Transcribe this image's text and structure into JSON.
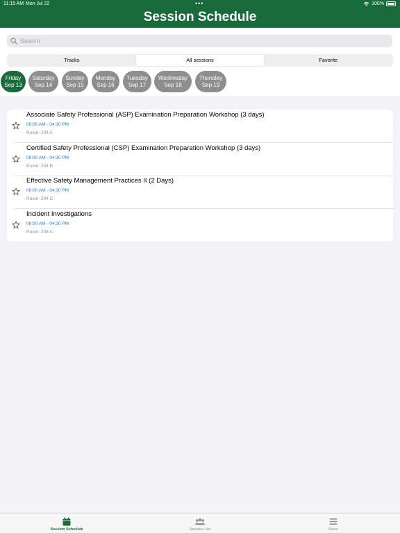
{
  "status_bar": {
    "time": "11:15 AM",
    "date": "Mon Jul 22",
    "dots": "•••",
    "battery": "100%"
  },
  "header": {
    "title": "Session Schedule"
  },
  "search": {
    "placeholder": "Search"
  },
  "segments": [
    {
      "label": "Tracks",
      "active": false
    },
    {
      "label": "All sessions",
      "active": true
    },
    {
      "label": "Favorite",
      "active": false
    }
  ],
  "days": [
    {
      "weekday": "Friday",
      "date": "Sep 13",
      "active": true
    },
    {
      "weekday": "Saturday",
      "date": "Sep 14",
      "active": false
    },
    {
      "weekday": "Sunday",
      "date": "Sep 15",
      "active": false
    },
    {
      "weekday": "Monday",
      "date": "Sep 16",
      "active": false
    },
    {
      "weekday": "Tuesday",
      "date": "Sep 17",
      "active": false
    },
    {
      "weekday": "Wednesday",
      "date": "Sep 18",
      "active": false
    },
    {
      "weekday": "Thursday",
      "date": "Sep 19",
      "active": false
    }
  ],
  "sessions": [
    {
      "title": "Associate Safety Professional (ASP) Examination Preparation Workshop (3 days)",
      "time": "08:00 AM - 04:30 PM",
      "room": "Room: 204 A"
    },
    {
      "title": "Certified Safety Professional (CSP) Examination Preparation Workshop (3 days)",
      "time": "08:00 AM - 04:30 PM",
      "room": "Room: 204 B"
    },
    {
      "title": "Effective Safety Management Practices II (2 Days)",
      "time": "08:00 AM - 04:30 PM",
      "room": "Room: 204 C"
    },
    {
      "title": "Incident Investigations",
      "time": "08:00 AM - 04:30 PM",
      "room": "Room: 208 A"
    }
  ],
  "tabbar": {
    "items": [
      {
        "label": "Session Schedule",
        "icon": "calendar-icon",
        "active": true
      },
      {
        "label": "Speaker List",
        "icon": "people-icon",
        "active": false
      },
      {
        "label": "Menu",
        "icon": "menu-icon",
        "active": false
      }
    ]
  },
  "colors": {
    "brand_green": "#1a6b3c",
    "time_blue": "#2a82d6",
    "day_inactive": "#8e8e8e"
  }
}
